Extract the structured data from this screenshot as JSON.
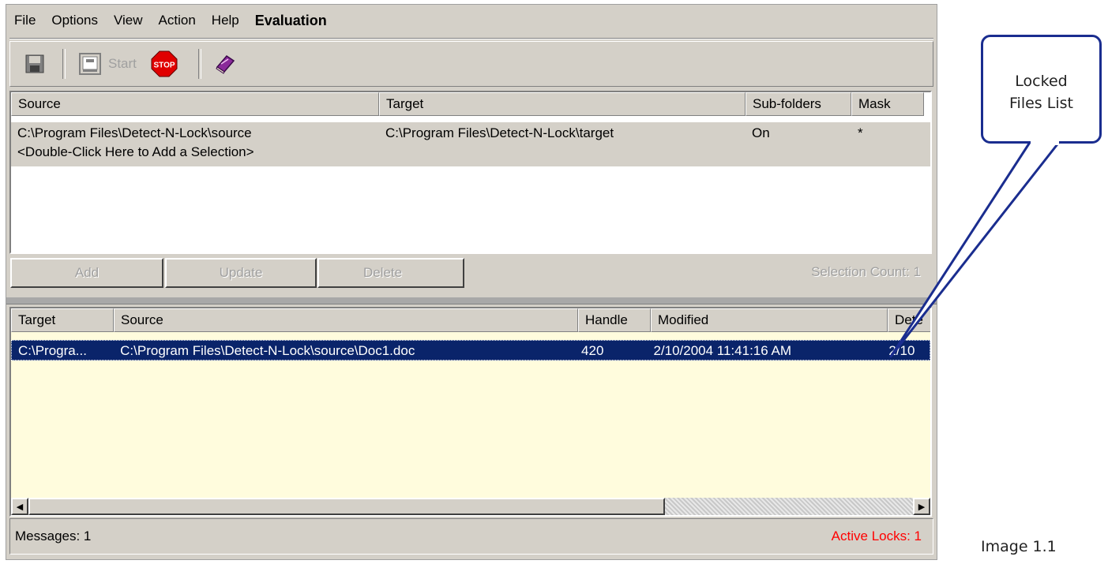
{
  "menu": {
    "file": "File",
    "options": "Options",
    "view": "View",
    "action": "Action",
    "help": "Help",
    "evaluation": "Evaluation"
  },
  "toolbar": {
    "start_label": "Start"
  },
  "selections": {
    "columns": [
      "Source",
      "Target",
      "Sub-folders",
      "Mask"
    ],
    "rows": [
      {
        "source": "C:\\Program Files\\Detect-N-Lock\\source",
        "target": "C:\\Program Files\\Detect-N-Lock\\target",
        "subfolders": "On",
        "mask": "*"
      }
    ],
    "add_hint": "<Double-Click Here to Add a Selection>",
    "buttons": {
      "add": "Add",
      "update": "Update",
      "delete": "Delete"
    },
    "count_label": "Selection Count: 1"
  },
  "locks": {
    "columns": [
      "Target",
      "Source",
      "Handle",
      "Modified",
      "Dete"
    ],
    "rows": [
      {
        "target": "C:\\Progra...",
        "source": "C:\\Program Files\\Detect-N-Lock\\source\\Doc1.doc",
        "handle": "420",
        "modified": "2/10/2004 11:41:16 AM",
        "detected": "2/10"
      }
    ],
    "scroll_fraction": 0.72
  },
  "status": {
    "messages": "Messages: 1",
    "active_locks": "Active Locks: 1"
  },
  "callout": {
    "line1": "Locked",
    "line2": "Files List"
  },
  "caption": "Image 1.1",
  "colors": {
    "window_bg": "#d4d0c8",
    "selected_row": "#0a246a",
    "locks_bg": "#fffcdd",
    "active_locks": "#ff0000",
    "callout_border": "#1a2d8f"
  }
}
